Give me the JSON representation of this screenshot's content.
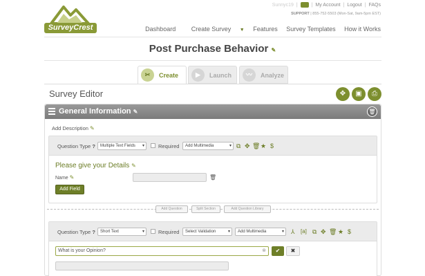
{
  "brand": {
    "logo_text": "SurveyCrest"
  },
  "toplinks": {
    "username": "Sunnyc19",
    "msg_count": "0",
    "my_account": "My Account",
    "logout": "Logout",
    "faqs": "FAQs"
  },
  "support": {
    "label": "SUPPORT",
    "text": "| 855-752-5503 (Mon-Sat, 9am-5pm EST)"
  },
  "nav": {
    "dashboard": "Dashboard",
    "create_survey": "Create Survey",
    "features": "Features",
    "templates": "Survey Templates",
    "how": "How it Works"
  },
  "page_title": "Post Purchase Behavior",
  "tabs": {
    "create": "Create",
    "launch": "Launch",
    "analyze": "Analyze"
  },
  "editor": {
    "title": "Survey Editor"
  },
  "section": {
    "title": "General Information",
    "add_description": "Add Description"
  },
  "q1": {
    "type_label": "Question Type",
    "type_help": "?",
    "type_value": "Multiple Text Fields",
    "required_label": "Required",
    "multimedia": "Add Multimedia",
    "question_text": "Please give your Details",
    "field_label": "Name",
    "add_field": "Add Field"
  },
  "divider_buttons": {
    "add_question": "Add Question",
    "split_section": "Split Section",
    "add_from_library": "Add Question Library"
  },
  "q2": {
    "type_label": "Question Type",
    "type_help": "?",
    "type_value": "Short Text",
    "required_label": "Required",
    "validation": "Select Validation",
    "multimedia": "Add Multimedia",
    "pipe_label": "[a]",
    "question_text": "What is your Opinion?"
  }
}
